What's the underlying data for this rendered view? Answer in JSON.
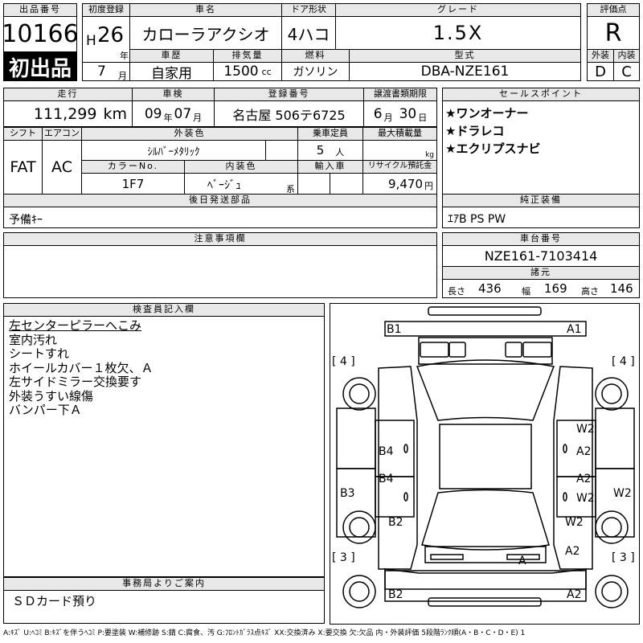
{
  "header": {
    "lot_label": "出品番号",
    "lot_number": "10166",
    "first_listing_badge": "初出品",
    "reg_label": "初度登録",
    "era": "H",
    "reg_year": "26",
    "year_unit": "年",
    "reg_month": "7",
    "month_unit": "月",
    "car_name_label": "車名",
    "car_name": "カローラアクシオ",
    "door_label": "ドア形状",
    "door_type": "4ハコ",
    "grade_label": "グレード",
    "grade": "1.5X",
    "score_label": "評価点",
    "score": "R",
    "history_label": "車歴",
    "history": "自家用",
    "displacement_label": "排気量",
    "displacement": "1500",
    "displacement_unit": "cc",
    "fuel_label": "燃料",
    "fuel": "ガソリン",
    "model_label": "型式",
    "model": "DBA-NZE161",
    "exterior_label": "外装",
    "exterior_score": "D",
    "interior_label": "内装",
    "interior_score": "C"
  },
  "row2": {
    "mileage_label": "走行",
    "mileage": "111,299",
    "mileage_unit": "km",
    "inspection_label": "車検",
    "insp_year": "09",
    "insp_year_unit": "年",
    "insp_month": "07",
    "insp_month_unit": "月",
    "plate_label": "登録番号",
    "plate": "名古屋 506テ6725",
    "transfer_label": "譲渡書類期限",
    "transfer_month": "6",
    "transfer_month_unit": "月",
    "transfer_day": "30",
    "transfer_day_unit": "日",
    "sales_label": "セールスポイント",
    "sales_points": [
      "★ワンオーナー",
      "★ドラレコ",
      "★エクリプスナビ"
    ]
  },
  "row3": {
    "shift_label": "シフト",
    "shift": "FAT",
    "ac_label": "エアコン",
    "ac": "AC",
    "ext_color_label": "外装色",
    "ext_color": "ｼﾙﾊﾞｰﾒﾀﾘｯｸ",
    "capacity_label": "乗車定員",
    "capacity": "5",
    "capacity_unit": "人",
    "max_load_label": "最大積載量",
    "max_load_unit": "kg",
    "color_no_label": "カラーNo.",
    "color_no": "1F7",
    "int_color_label": "内装色",
    "int_color": "ﾍﾞｰｼﾞｭ",
    "int_color_suffix": "系",
    "import_label": "輸入車",
    "recycle_label": "リサイクル預託金",
    "recycle": "9,470",
    "recycle_unit": "円"
  },
  "later_parts": {
    "label": "後日発送部品",
    "value": "予備ｷｰ"
  },
  "genuine": {
    "label": "純正装備",
    "value": "ｴｱB PS PW"
  },
  "notes": {
    "label": "注意事項欄"
  },
  "chassis": {
    "label": "車台番号",
    "value": "NZE161-7103414",
    "dims_label": "諸元",
    "length_label": "長さ",
    "length": "436",
    "width_label": "幅",
    "width": "169",
    "height_label": "高さ",
    "height": "146"
  },
  "inspector": {
    "label": "検査員記入欄",
    "lines": [
      "左センターピラーへこみ",
      "室内汚れ",
      "シートすれ",
      "ホイールカバー１枚欠、Ａ",
      "左サイドミラー交換要す",
      "外装うすい線傷",
      "バンパー下Ａ"
    ]
  },
  "office": {
    "label": "事務局よりご案内",
    "value": "ＳＤカード預り"
  },
  "diagram": {
    "marks": [
      "B1",
      "A1",
      "[ 4 ]",
      "[ 4 ]",
      "W2",
      "B4",
      "A2",
      "B4",
      "A2",
      "B3",
      "W2",
      "W2",
      "B2",
      "W2",
      "A2",
      "[ 3 ]",
      "[ 3 ]",
      "A",
      "B2",
      "A2"
    ]
  },
  "legend": "A:ｷｽﾞ U:ﾍｺﾐ B:ｷｽﾞを伴うﾍｺﾐ P:要塗装 W:補修跡 S:錆 C:腐食、汚 G:ﾌﾛﾝﾄｶﾞﾗｽ点ｷｽﾞ XX:交換済み X:要交換 欠:欠品 内・外装評価 5段階ﾗﾝｸ順(A・B・C・D・E) 1"
}
